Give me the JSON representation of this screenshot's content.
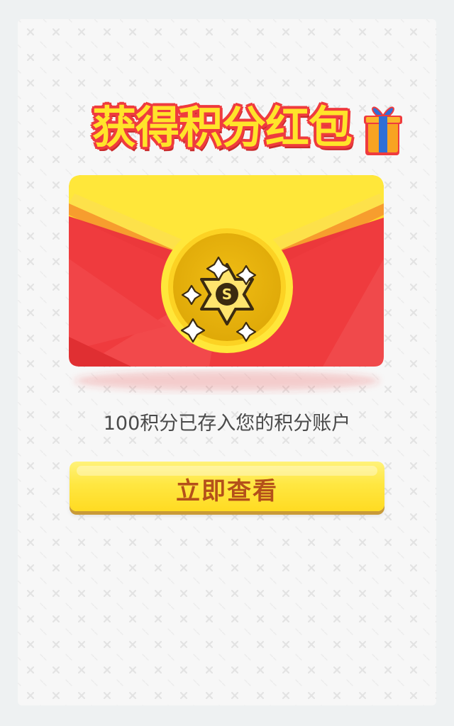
{
  "title": "获得积分红包",
  "coin": {
    "symbol": "S"
  },
  "message": "100积分已存入您的积分账户",
  "button": {
    "label": "立即查看"
  },
  "colors": {
    "background": "#eef1f2",
    "card": "#f7f7f7",
    "envelope_red": "#ef3b3e",
    "envelope_flap": "#ffe73a",
    "coin_gold": "#e8b20e",
    "button_yellow": "#ffe742",
    "button_text": "#b4501a",
    "title_text": "#ffe42a"
  },
  "icons": [
    "gift-icon",
    "coin-star-icon",
    "sparkle-icon"
  ]
}
